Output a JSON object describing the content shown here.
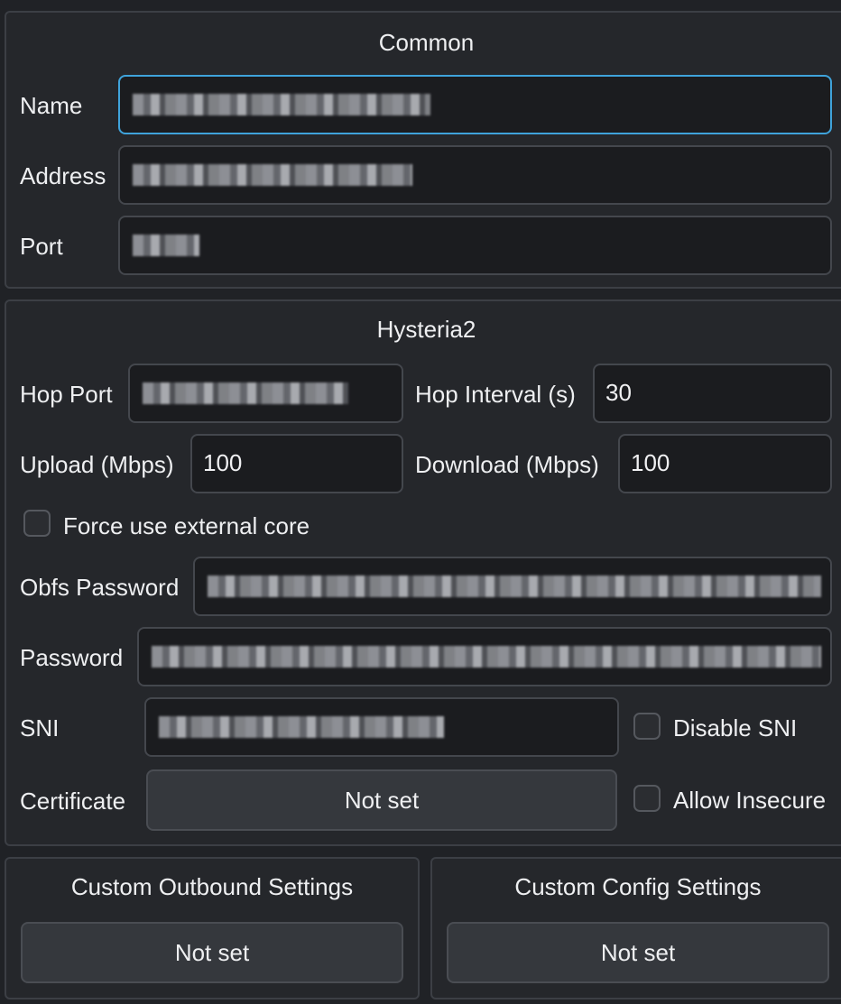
{
  "common": {
    "title": "Common",
    "name_label": "Name",
    "address_label": "Address",
    "port_label": "Port"
  },
  "hysteria2": {
    "title": "Hysteria2",
    "hop_port_label": "Hop Port",
    "hop_interval_label": "Hop Interval (s)",
    "hop_interval_value": "30",
    "upload_label": "Upload (Mbps)",
    "upload_value": "100",
    "download_label": "Download (Mbps)",
    "download_value": "100",
    "force_external_core_label": "Force use external core",
    "force_external_core_checked": false,
    "obfs_password_label": "Obfs Password",
    "password_label": "Password",
    "sni_label": "SNI",
    "disable_sni_label": "Disable SNI",
    "disable_sni_checked": false,
    "certificate_label": "Certificate",
    "certificate_button": "Not set",
    "allow_insecure_label": "Allow Insecure",
    "allow_insecure_checked": false
  },
  "custom_outbound": {
    "title": "Custom Outbound Settings",
    "button": "Not set"
  },
  "custom_config": {
    "title": "Custom Config Settings",
    "button": "Not set"
  },
  "colors": {
    "background": "#202226",
    "focus_border": "#3fa3db",
    "field_background": "#1b1c1f"
  }
}
